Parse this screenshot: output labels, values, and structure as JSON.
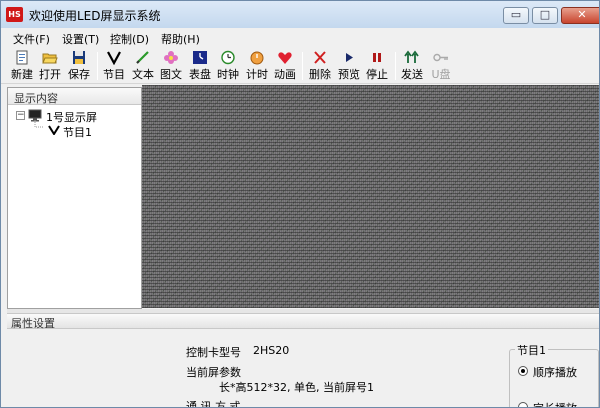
{
  "window": {
    "title": "欢迎使用LED屏显示系统",
    "app_icon_text": "HS",
    "minimize": "▭",
    "maximize": "□",
    "close": "✕"
  },
  "menu": [
    "文件(F)",
    "设置(T)",
    "控制(D)",
    "帮助(H)"
  ],
  "toolbar": {
    "new": "新建",
    "open": "打开",
    "save": "保存",
    "program": "节目",
    "text": "文本",
    "image": "图文",
    "dial": "表盘",
    "clock": "时钟",
    "timer": "计时",
    "animation": "动画",
    "delete": "删除",
    "preview": "预览",
    "stop": "停止",
    "send": "发送",
    "udisk": "U盘"
  },
  "left_panel": {
    "header": "显示内容",
    "tree_expander": "−",
    "screen_node": "1号显示屏",
    "program_node": "节目1"
  },
  "properties": {
    "header": "属性设置",
    "card_model_label": "控制卡型号",
    "card_model_value": "2HS20",
    "screen_params_label": "当前屏参数",
    "screen_params_value": "长*高512*32, 单色, 当前屏号1",
    "comm_label": "通 讯 方 式",
    "group_title": "节目1",
    "play_order": "顺序播放",
    "fixed_length": "定长播放"
  },
  "colors": {
    "title_gradient_top": "#dce9f7",
    "close_red": "#c8452e",
    "preview_noise": "#6a6a6a"
  }
}
